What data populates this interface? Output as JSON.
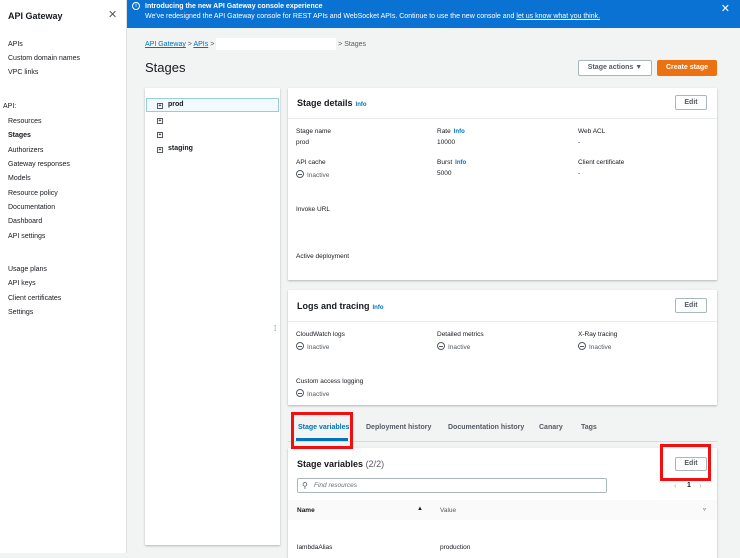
{
  "sidebar": {
    "title": "API Gateway",
    "items": [
      "APIs",
      "Custom domain names",
      "VPC links"
    ],
    "api_section": "API:",
    "api_items": [
      "Resources",
      "Stages",
      "Authorizers",
      "Gateway responses",
      "Models",
      "Resource policy",
      "Documentation",
      "Dashboard",
      "API settings"
    ],
    "bottom_items": [
      "Usage plans",
      "API keys",
      "Client certificates",
      "Settings"
    ]
  },
  "banner": {
    "title": "Introducing the new API Gateway console experience",
    "text": "We've redesigned the API Gateway console for REST APIs and WebSocket APIs. Continue to use the new console and ",
    "link": "let us know what you think."
  },
  "breadcrumb": {
    "items": [
      "API Gateway",
      "APIs"
    ],
    "current": "Stages"
  },
  "page": {
    "title": "Stages",
    "stage_actions": "Stage actions ▼",
    "create_stage": "Create stage"
  },
  "tree": {
    "items": [
      "prod",
      "",
      "",
      "staging"
    ]
  },
  "stage_details": {
    "title": "Stage details",
    "info": "Info",
    "edit": "Edit",
    "stage_name_label": "Stage name",
    "stage_name": "prod",
    "rate_label": "Rate",
    "rate": "10000",
    "web_acl_label": "Web ACL",
    "web_acl": "-",
    "api_cache_label": "API cache",
    "api_cache": "Inactive",
    "burst_label": "Burst",
    "burst": "5000",
    "client_cert_label": "Client certificate",
    "client_cert": "-",
    "invoke_url_label": "Invoke URL",
    "active_deployment_label": "Active deployment"
  },
  "logs": {
    "title": "Logs and tracing",
    "info": "Info",
    "edit": "Edit",
    "cloudwatch_label": "CloudWatch logs",
    "cloudwatch": "Inactive",
    "metrics_label": "Detailed metrics",
    "metrics": "Inactive",
    "xray_label": "X-Ray tracing",
    "xray": "Inactive",
    "access_label": "Custom access logging",
    "access": "Inactive"
  },
  "tabs": [
    "Stage variables",
    "Deployment history",
    "Documentation history",
    "Canary",
    "Tags"
  ],
  "variables": {
    "title": "Stage variables",
    "count": "(2/2)",
    "edit": "Edit",
    "search_placeholder": "Find resources",
    "page": "1",
    "col_name": "Name",
    "col_value": "Value",
    "rows": [
      {
        "name": "lambdaAlias",
        "value": "production"
      }
    ]
  }
}
